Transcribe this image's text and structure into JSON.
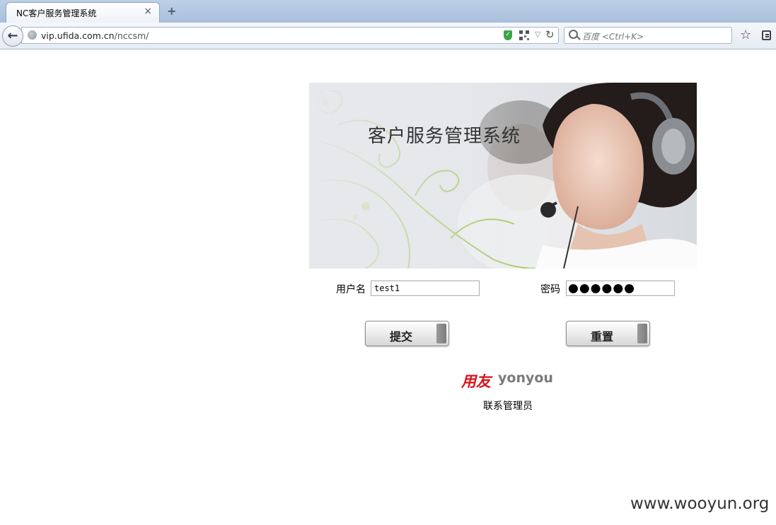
{
  "browser": {
    "tab_title": "NC客户服务管理系统",
    "tab_close": "×",
    "new_tab": "+",
    "url_host": "vip.ufida.com.cn",
    "url_path": "/nccsm/",
    "search_placeholder": "百度 <Ctrl+K>",
    "back": "←",
    "reload": "C",
    "star": "☆"
  },
  "banner": {
    "title": "客户服务管理系统"
  },
  "login": {
    "username_label": "用户名",
    "username_value": "test1",
    "password_label": "密码",
    "password_mask": "●●●●●●",
    "submit_label": "提交",
    "reset_label": "重置"
  },
  "footer": {
    "logo_cn": "用友",
    "logo_en": "yonyou",
    "contact_label": "联系管理员"
  },
  "watermark": "www.wooyun.org",
  "colors": {
    "logo_red": "#d8131b",
    "swirl_green": "#9bc84a"
  },
  "icons": [
    "back-arrow-icon",
    "globe-icon",
    "shield-icon",
    "qr-code-icon",
    "reload-icon",
    "search-icon",
    "star-icon",
    "bookmarks-icon"
  ]
}
